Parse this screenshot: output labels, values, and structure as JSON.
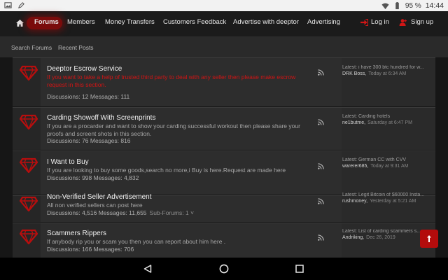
{
  "status_bar": {
    "battery": "95 %",
    "time": "14:44"
  },
  "nav": {
    "items": [
      "Forums",
      "Members",
      "Money Transfers",
      "Customers Feedback",
      "Advertise with deeptor",
      "Advertising"
    ],
    "login": "Log in",
    "signup": "Sign up"
  },
  "subnav": {
    "search": "Search Forums",
    "recent": "Recent Posts"
  },
  "forums": [
    {
      "title": "Deeptor Escrow Service",
      "desc": "If you want to take a help of trusted third party to deal with any seller then please make escrow request in this section.",
      "stats": "Discussions: 12 Messages: 111",
      "latest": "Latest: i have 300 btc hundred for w...",
      "user": "DRK Boss,",
      "time": "Today at 6:34 AM"
    },
    {
      "title": "Carding Showoff With Screenprints",
      "desc": "If you are a procarder and want to show your carding successful workout then please share your proofs and screent shots in this section.",
      "stats": "Discussions: 76 Messages: 816",
      "latest": "Latest: Carding hotels",
      "user": "ne1butme,",
      "time": "Saturday at 6:47 PM"
    },
    {
      "title": "I Want to Buy",
      "desc": "If you are looking to buy some goods,search no more,i Buy is here.Request are made here",
      "stats": "Discussions: 998 Messages: 4,832",
      "latest": "Latest: German CC with CVV",
      "user": "warerer685,",
      "time": "Today at 9:31 AM"
    },
    {
      "title": "Non-Verified Seller Advertisement",
      "desc": "All non verified sellers can post here",
      "stats": "Discussions: 4,516 Messages: 11,655",
      "subforums": "Sub-Forums: 1 ˅",
      "latest": "Latest: Legit Bitcoin of $60000 Insta...",
      "user": "rushmoney,",
      "time": "Yesterday at 5:21 AM"
    },
    {
      "title": "Scammers Rippers",
      "desc": "If anybody rip you or scam you then you can report about him here .",
      "stats": "Discussions: 166 Messages: 706",
      "latest": "Latest: List of carding scammers s...",
      "user": "Andriking,",
      "time": "Dec 26, 2019"
    }
  ],
  "colors": {
    "accent": "#b30c0c",
    "background": "#161616",
    "row": "#2d2d2d"
  }
}
